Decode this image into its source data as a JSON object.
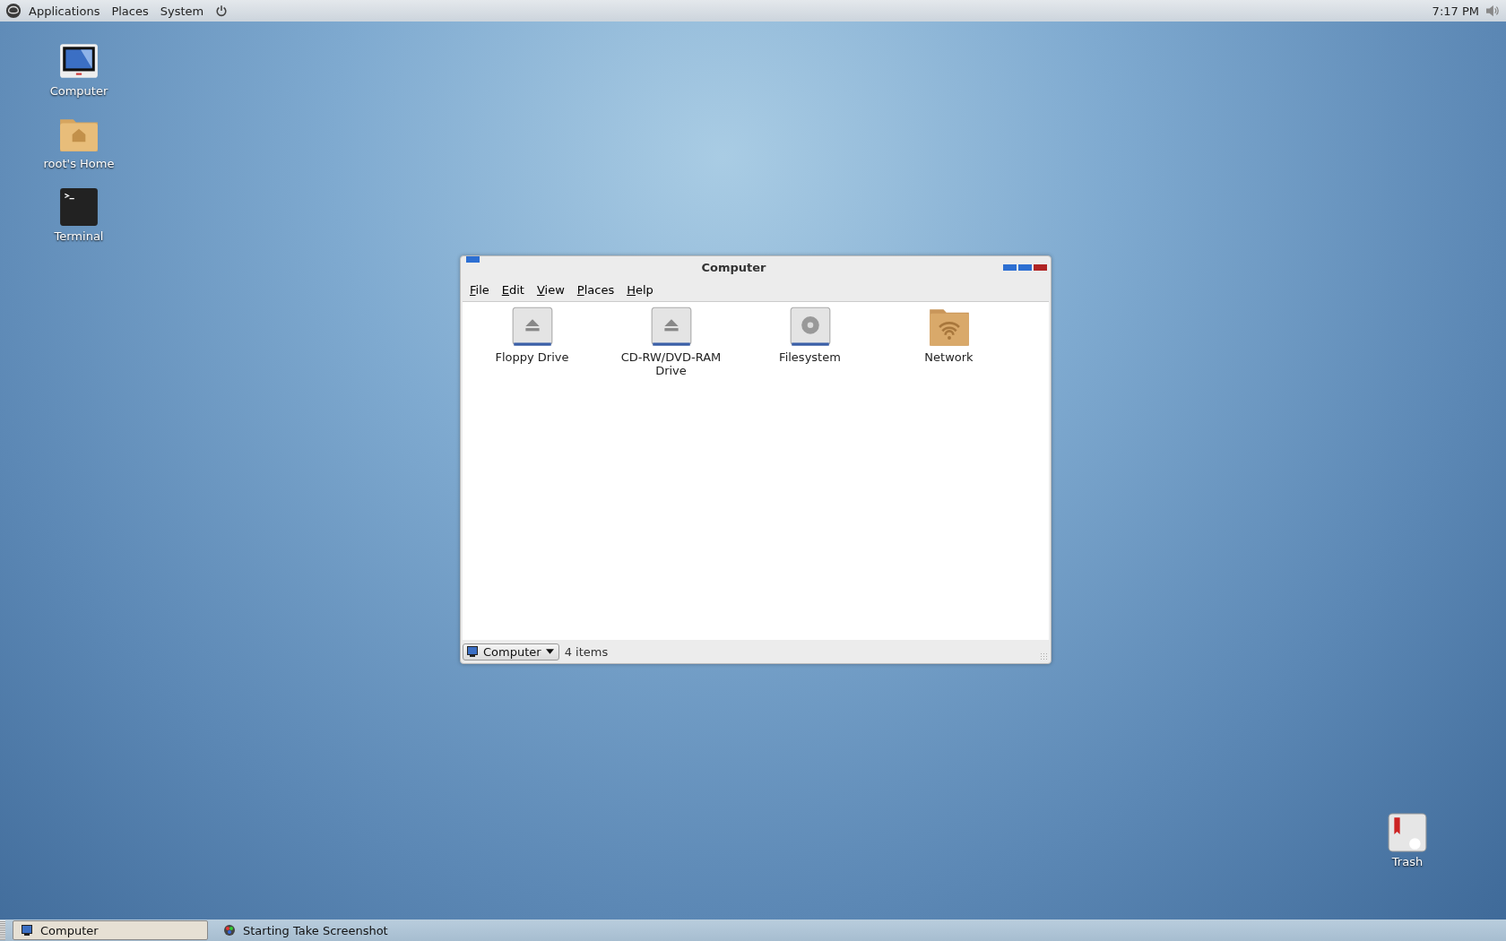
{
  "top_panel": {
    "menus": [
      "Applications",
      "Places",
      "System"
    ],
    "clock": "7:17 PM"
  },
  "desktop_icons": [
    {
      "kind": "computer",
      "label": "Computer"
    },
    {
      "kind": "home",
      "label": "root's Home"
    },
    {
      "kind": "terminal",
      "label": "Terminal"
    }
  ],
  "trash": {
    "label": "Trash"
  },
  "window": {
    "title": "Computer",
    "menu": [
      "File",
      "Edit",
      "View",
      "Places",
      "Help"
    ],
    "items": [
      {
        "kind": "drive",
        "label": "Floppy Drive"
      },
      {
        "kind": "drive",
        "label": "CD-RW/DVD-RAM Drive"
      },
      {
        "kind": "disk",
        "label": "Filesystem"
      },
      {
        "kind": "network",
        "label": "Network"
      }
    ],
    "location": "Computer",
    "status": "4 items"
  },
  "taskbar": [
    {
      "kind": "computer",
      "label": "Computer",
      "selected": true
    },
    {
      "kind": "screenshot",
      "label": "Starting Take Screenshot",
      "selected": false
    }
  ]
}
